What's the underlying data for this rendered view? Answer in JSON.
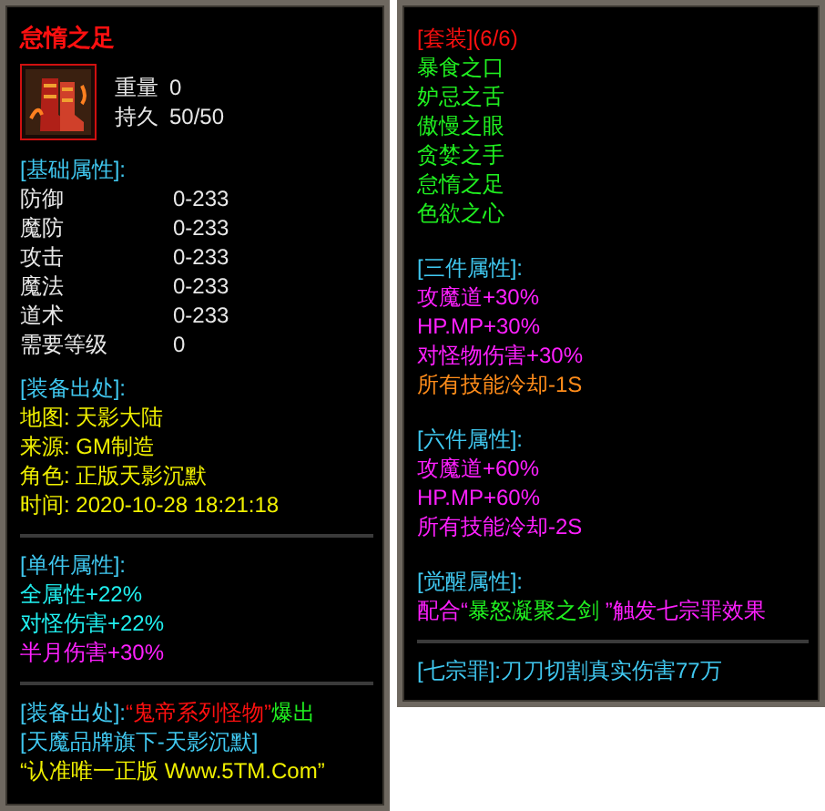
{
  "left_panel": {
    "title": {
      "text": "怠惰之足",
      "color": "#ff1010"
    },
    "item": {
      "stats": [
        {
          "label": "重量",
          "value": "0"
        },
        {
          "label": "持久",
          "value": "50/50"
        }
      ]
    },
    "sections": [
      {
        "kind": "text",
        "lines": [
          [
            {
              "text": "[基础属性]:",
              "color": "#40c8f0"
            }
          ]
        ],
        "rows": [
          {
            "label": "防御",
            "value": "0-233"
          },
          {
            "label": "魔防",
            "value": "0-233"
          },
          {
            "label": "攻击",
            "value": "0-233"
          },
          {
            "label": "魔法",
            "value": "0-233"
          },
          {
            "label": "道术",
            "value": "0-233"
          },
          {
            "label": "需要等级",
            "value": "0"
          }
        ]
      },
      {
        "kind": "text",
        "lines": [
          [
            {
              "text": "[装备出处]:",
              "color": "#40c8f0"
            }
          ],
          [
            {
              "text": "地图: 天影大陆",
              "color": "#f0f000"
            }
          ],
          [
            {
              "text": "来源: GM制造",
              "color": "#f0f000"
            }
          ],
          [
            {
              "text": "角色: 正版天影沉默",
              "color": "#f0f000"
            }
          ],
          [
            {
              "text": "时间: 2020-10-28 18:21:18",
              "color": "#f0f000"
            }
          ]
        ]
      },
      {
        "kind": "divider"
      },
      {
        "kind": "text",
        "lines": [
          [
            {
              "text": "[单件属性]:",
              "color": "#40c8f0"
            }
          ],
          [
            {
              "text": "全属性+22%",
              "color": "#20f0f0"
            }
          ],
          [
            {
              "text": "对怪伤害+22%",
              "color": "#20f0f0"
            }
          ],
          [
            {
              "text": "半月伤害+30%",
              "color": "#ff20ff"
            }
          ]
        ]
      },
      {
        "kind": "divider"
      },
      {
        "kind": "text",
        "lines": [
          [
            {
              "text": "[装备出处]:",
              "color": "#40c8f0"
            },
            {
              "text": "“鬼帝系列怪物”",
              "color": "#ff1010"
            },
            {
              "text": "爆出",
              "color": "#20f020"
            }
          ],
          [
            {
              "text": "[天魔品牌旗下-天影沉默]",
              "color": "#40c8f0"
            }
          ],
          [
            {
              "text": "“认准唯一正版 Www.5TM.Com”",
              "color": "#f0f000"
            }
          ]
        ]
      }
    ]
  },
  "right_panel": {
    "sections": [
      {
        "kind": "text",
        "lines": [
          [
            {
              "text": "[套装](6/6)",
              "color": "#ff1010"
            }
          ],
          [
            {
              "text": "暴食之口",
              "color": "#20f020"
            }
          ],
          [
            {
              "text": "妒忌之舌",
              "color": "#20f020"
            }
          ],
          [
            {
              "text": "傲慢之眼",
              "color": "#20f020"
            }
          ],
          [
            {
              "text": "贪婪之手",
              "color": "#20f020"
            }
          ],
          [
            {
              "text": "怠惰之足",
              "color": "#20f020"
            }
          ],
          [
            {
              "text": "色欲之心",
              "color": "#20f020"
            }
          ]
        ]
      },
      {
        "kind": "text",
        "lines": [
          [
            {
              "text": "[三件属性]:",
              "color": "#40c8f0"
            }
          ],
          [
            {
              "text": "攻魔道+30%",
              "color": "#ff20ff"
            }
          ],
          [
            {
              "text": "HP.MP+30%",
              "color": "#ff20ff"
            }
          ],
          [
            {
              "text": "对怪物伤害+30%",
              "color": "#ff20ff"
            }
          ],
          [
            {
              "text": "所有技能冷却-1S",
              "color": "#ff8c1a"
            }
          ]
        ]
      },
      {
        "kind": "text",
        "lines": [
          [
            {
              "text": "[六件属性]:",
              "color": "#40c8f0"
            }
          ],
          [
            {
              "text": "攻魔道+60%",
              "color": "#ff20ff"
            }
          ],
          [
            {
              "text": "HP.MP+60%",
              "color": "#ff20ff"
            }
          ],
          [
            {
              "text": "所有技能冷却-2S",
              "color": "#ff20ff"
            }
          ]
        ]
      },
      {
        "kind": "text",
        "lines": [
          [
            {
              "text": "[觉醒属性]:",
              "color": "#40c8f0"
            }
          ],
          [
            {
              "text": "配合“",
              "color": "#ff20ff"
            },
            {
              "text": "暴怒凝聚之剑 ",
              "color": "#20f020"
            },
            {
              "text": "”触发七宗罪效果",
              "color": "#ff20ff"
            }
          ]
        ]
      },
      {
        "kind": "divider"
      },
      {
        "kind": "text",
        "lines": [
          [
            {
              "text": "[七宗罪]:刀刀切割真实伤害77万",
              "color": "#40c8f0"
            }
          ]
        ]
      }
    ]
  }
}
